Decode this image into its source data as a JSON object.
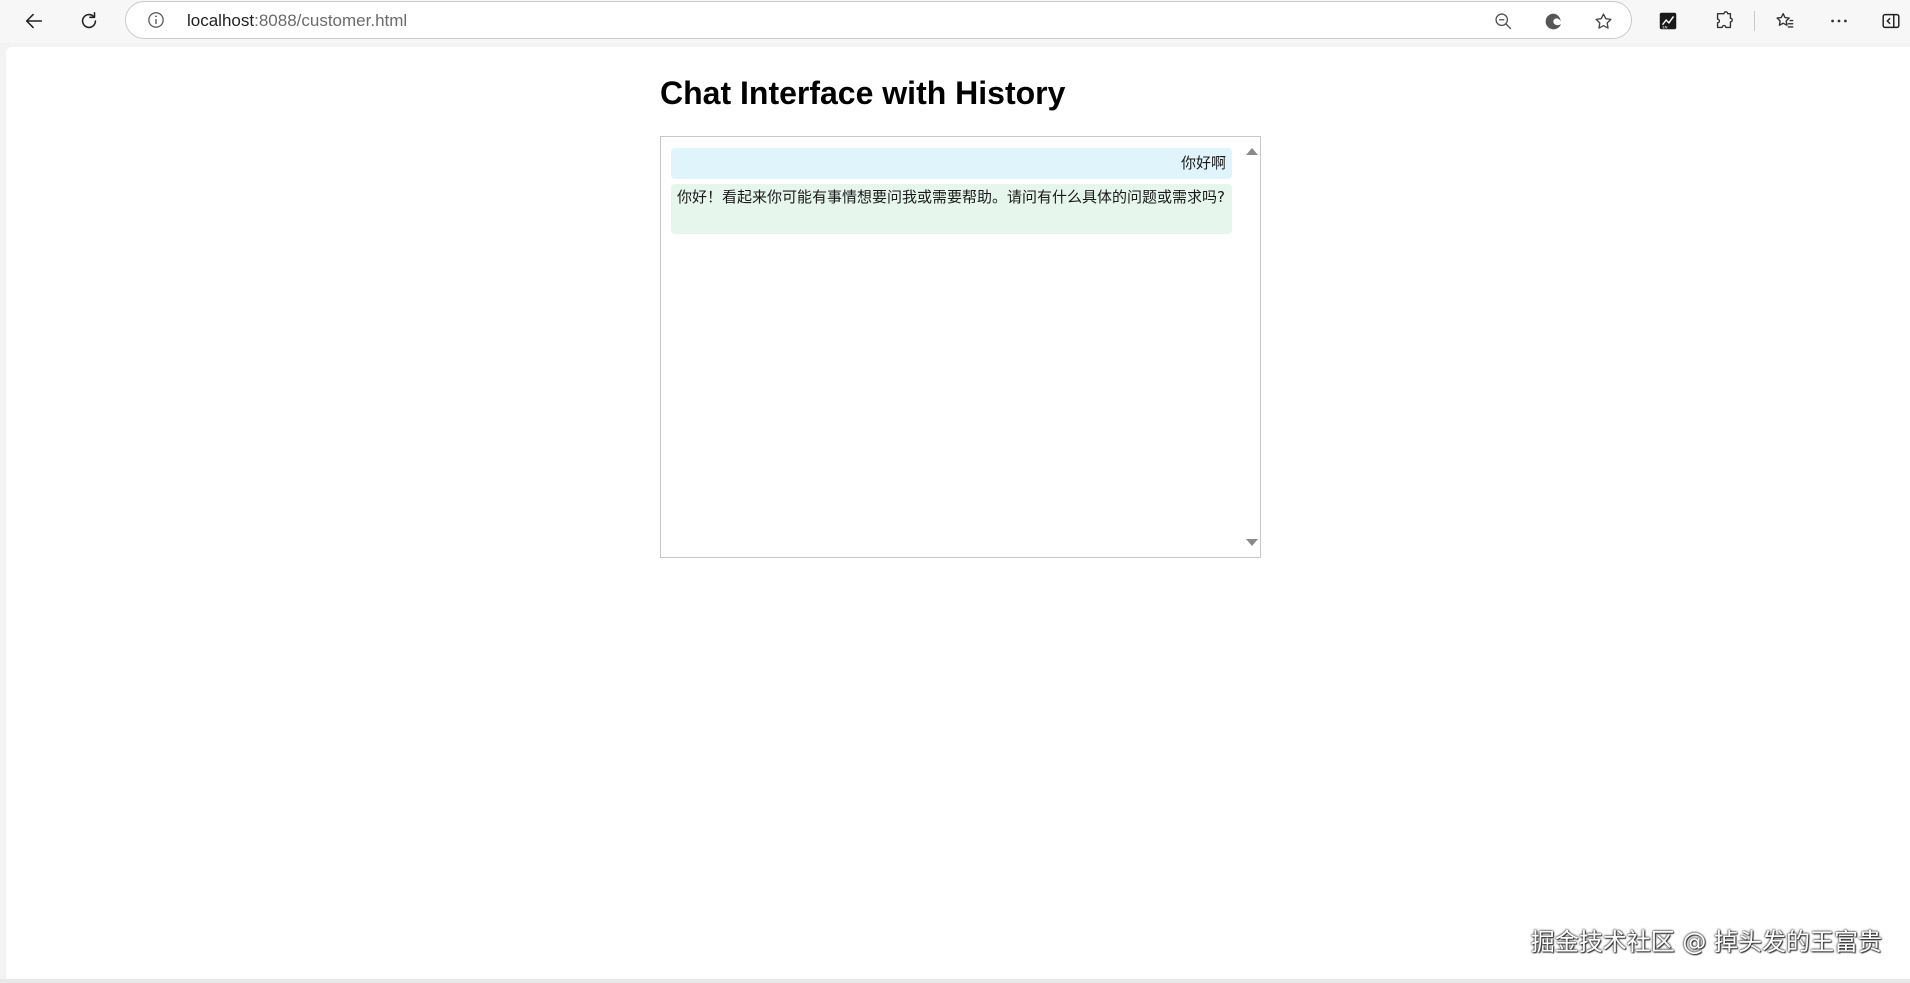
{
  "browser": {
    "url_host": "localhost",
    "url_rest": ":8088/customer.html",
    "toolbar_icons": [
      "back-arrow-icon",
      "refresh-icon",
      "info-icon",
      "zoom-out-icon",
      "edge-logo-icon",
      "star-icon",
      "extension-app-icon",
      "puzzle-icon",
      "favorites-icon",
      "more-icon",
      "sidebar-toggle-icon"
    ]
  },
  "page": {
    "title": "Chat Interface with History"
  },
  "chat": {
    "messages": [
      {
        "role": "user",
        "text": "你好啊"
      },
      {
        "role": "assistant",
        "text": "你好！看起来你可能有事情想要问我或需要帮助。请问有什么具体的问题或需求吗?"
      }
    ]
  },
  "watermark": "掘金技术社区 @ 掉头发的王富贵",
  "colors": {
    "user_bubble": "#e0f5fb",
    "assistant_bubble": "#e6f6ec",
    "chat_border": "#c8c8c8"
  }
}
